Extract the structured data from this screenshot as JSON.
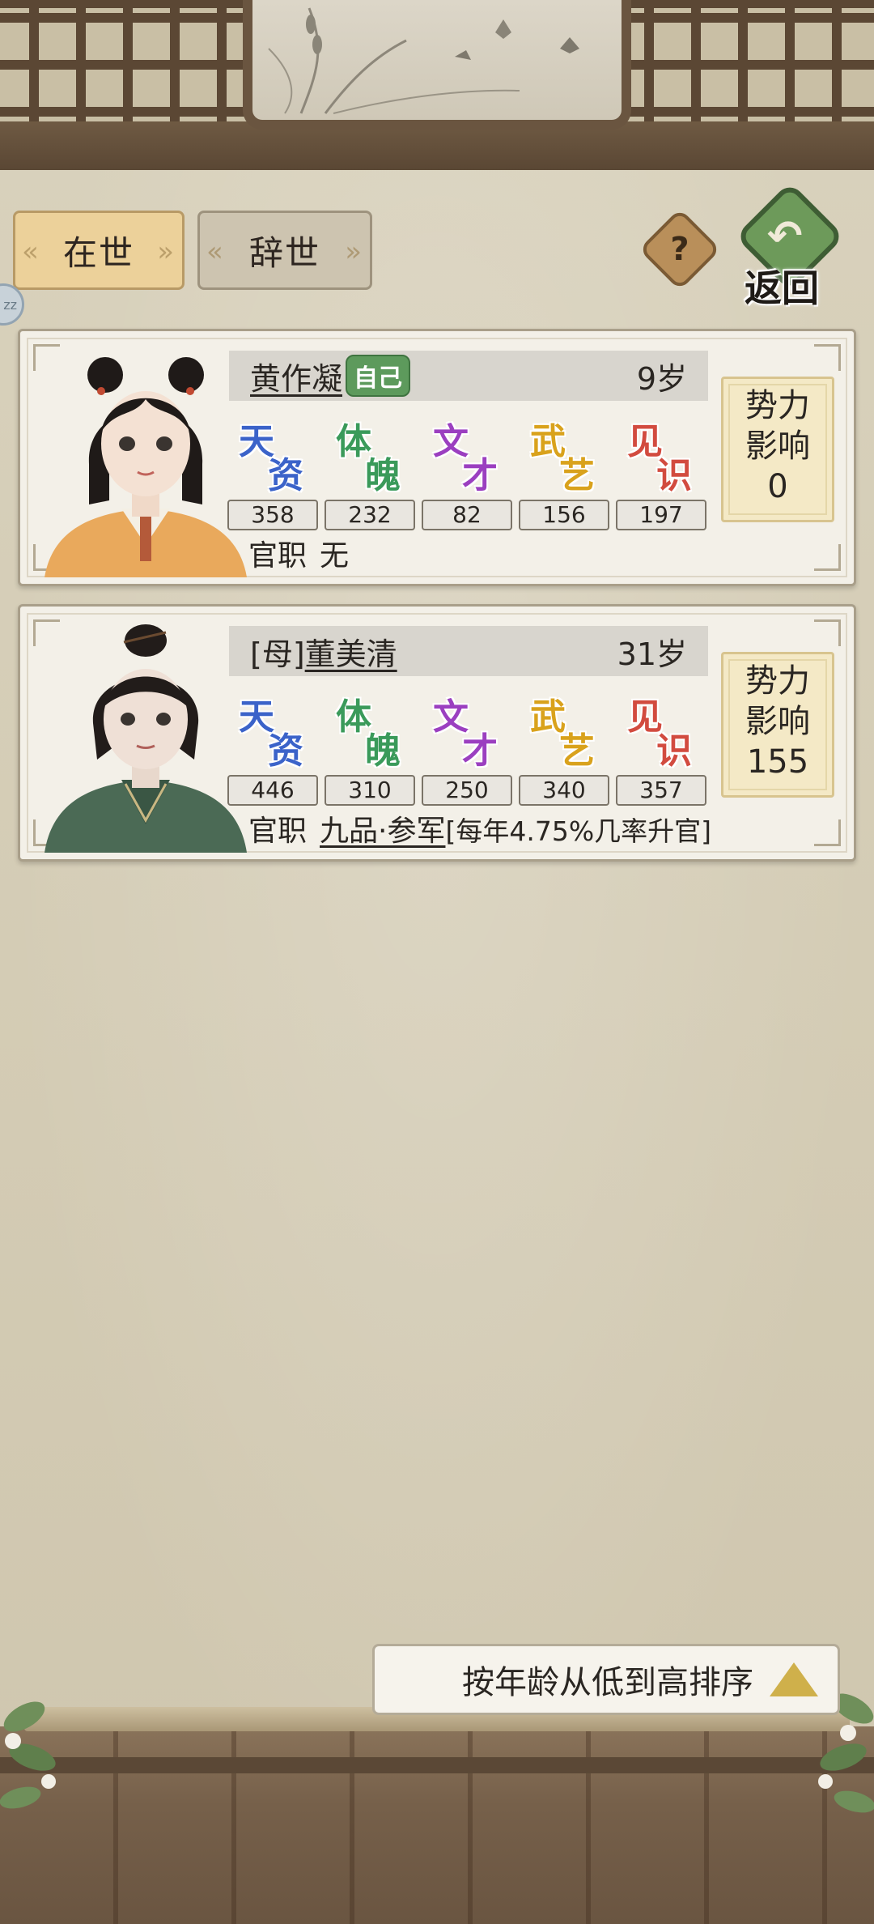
{
  "tabs": [
    {
      "label": "在世",
      "active": true
    },
    {
      "label": "辞世",
      "active": false
    }
  ],
  "header": {
    "help_label": "?",
    "back_label": "返回",
    "side_bubble_label": "zz"
  },
  "stat_names": [
    {
      "top": "天",
      "bottom": "资",
      "color": "#3b63c9"
    },
    {
      "top": "体",
      "bottom": "魄",
      "color": "#3a9a5a"
    },
    {
      "top": "文",
      "bottom": "才",
      "color": "#9b3fc0"
    },
    {
      "top": "武",
      "bottom": "艺",
      "color": "#d9a21c"
    },
    {
      "top": "见",
      "bottom": "识",
      "color": "#d24b3f"
    }
  ],
  "characters": [
    {
      "relation": "",
      "name": "黄作凝",
      "badge": "自己",
      "age": "9岁",
      "stats": [
        "358",
        "232",
        "82",
        "156",
        "197"
      ],
      "office_label": "官职",
      "office_post": "无",
      "office_rate": "",
      "influence_line1": "势力",
      "influence_line2": "影响",
      "influence_value": "0"
    },
    {
      "relation": "[母]",
      "name": "董美清",
      "badge": "",
      "age": "31岁",
      "stats": [
        "446",
        "310",
        "250",
        "340",
        "357"
      ],
      "office_label": "官职",
      "office_post": "九品·参军",
      "office_rate": "[每年4.75%几率升官]",
      "influence_line1": "势力",
      "influence_line2": "影响",
      "influence_value": "155"
    }
  ],
  "sort": {
    "label": "按年龄从低到高排序"
  },
  "colors": {
    "background": "#d6ceb8",
    "tab_active": "#ecd19a",
    "tab_inactive": "#cdc4b0",
    "back_button": "#6d9a5a",
    "self_badge": "#5d9a5c",
    "influence_box": "#f4e9c6",
    "sort_triangle": "#cfb04b"
  },
  "icons": [
    "help-icon",
    "back-arrow-icon",
    "sort-ascending-icon",
    "flower-decoration-icon"
  ]
}
